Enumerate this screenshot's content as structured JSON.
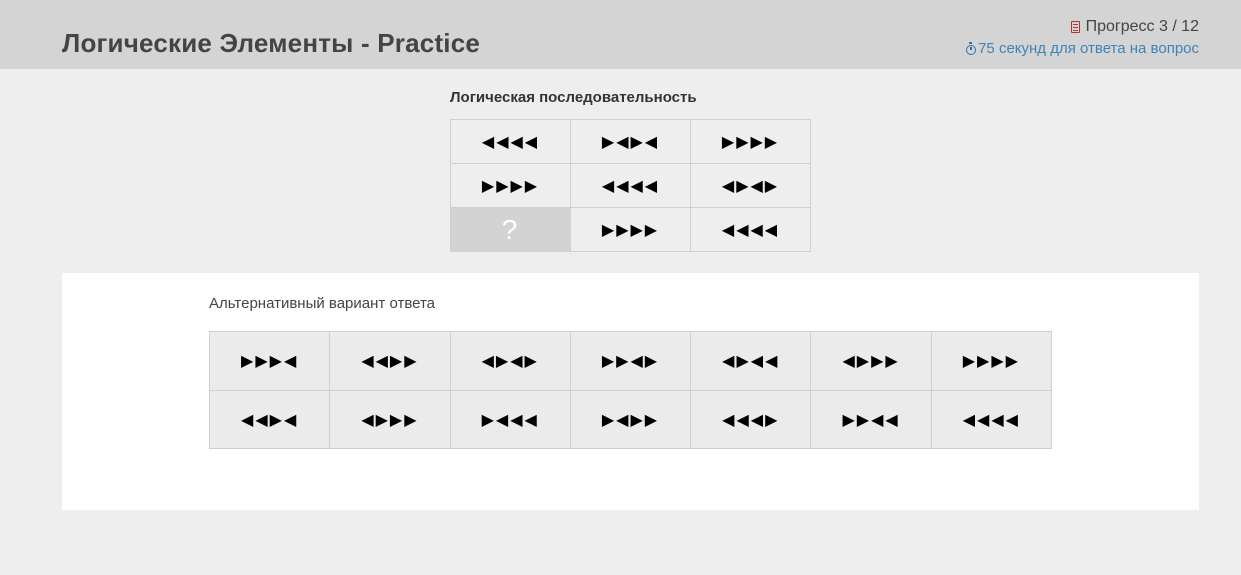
{
  "header": {
    "title": "Логические Элементы - Practice",
    "progress_label": "Прогресс 3 / 12",
    "timer_label": "75 секунд для ответа на вопрос",
    "progress_icon": "document-icon",
    "timer_icon": "stopwatch-icon"
  },
  "sequence": {
    "title": "Логическая последовательность",
    "cells": [
      "◀◀◀◀",
      "▶◀▶◀",
      "▶▶▶▶",
      "▶▶▶▶",
      "◀◀◀◀",
      "◀▶◀▶",
      "?",
      "▶▶▶▶",
      "◀◀◀◀"
    ]
  },
  "answers": {
    "title": "Альтернативный вариант ответа",
    "options": [
      "▶▶▶◀",
      "◀◀▶▶",
      "◀▶◀▶",
      "▶▶◀▶",
      "◀▶◀◀",
      "◀▶▶▶",
      "▶▶▶▶",
      "◀◀▶◀",
      "◀▶▶▶",
      "▶◀◀◀",
      "▶◀▶▶",
      "◀◀◀▶",
      "▶▶◀◀",
      "◀◀◀◀"
    ]
  },
  "colors": {
    "header_bg": "#d4d4d4",
    "page_bg": "#eeeeee",
    "timer_text": "#3d84b8",
    "progress_icon": "#b5322e",
    "unknown_cell_bg": "#d3d3d3"
  }
}
